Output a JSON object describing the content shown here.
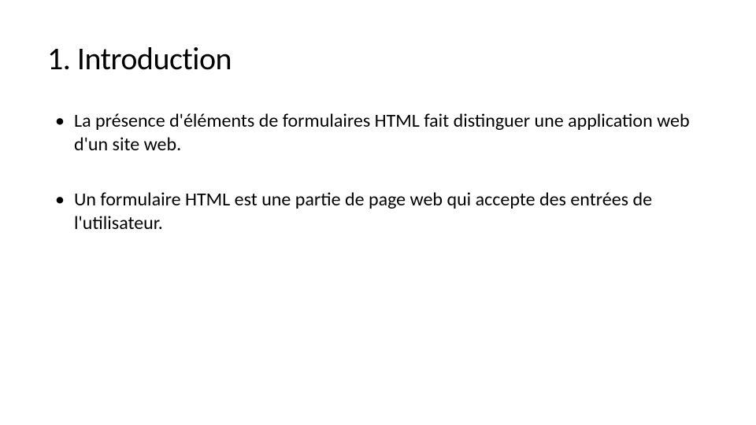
{
  "slide": {
    "title": "1. Introduction",
    "bullets": [
      "La présence d'éléments de formulaires HTML fait distinguer une application web d'un site web.",
      "Un formulaire HTML est une partie de page web qui accepte des entrées de l'utilisateur."
    ]
  }
}
